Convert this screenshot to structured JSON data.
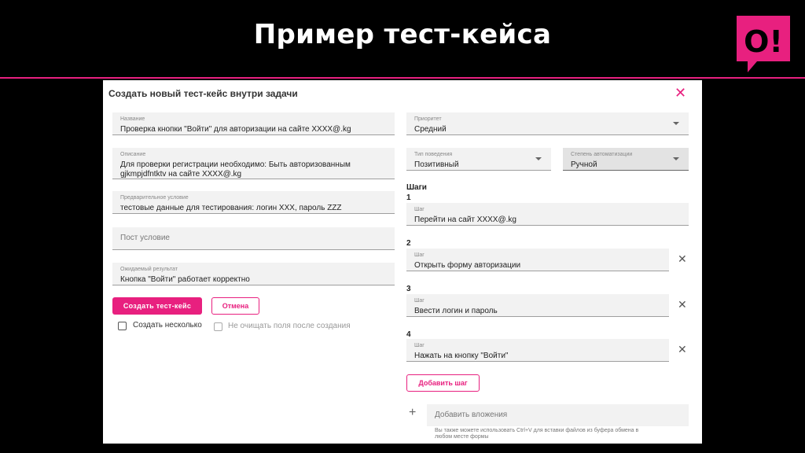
{
  "slide": {
    "title": "Пример тест-кейса",
    "logo_text": "О!",
    "accent_color": "#e8207f"
  },
  "dialog": {
    "title": "Создать новый тест-кейс внутри задачи",
    "close_icon": "close-icon",
    "fields": {
      "name": {
        "label": "Название",
        "value": "Проверка кнопки \"Войти\" для авторизации на сайте XXXX@.kg"
      },
      "description": {
        "label": "Описание",
        "value_line1": "Для проверки  регистрации необходимо: Быть авторизованным",
        "value_line2": "gjkmpjdfntktv  на сайте  XXXX@.kg"
      },
      "precondition": {
        "label": "Предварительное условие",
        "value": "тестовые данные для тестирования: логин XXX, пароль ZZZ"
      },
      "postcondition": {
        "placeholder": "Пост условие"
      },
      "expected": {
        "label": "Ожидаемый результат",
        "value": "Кнопка \"Войти\" работает корректно"
      }
    },
    "buttons": {
      "create": "Создать тест-кейс",
      "cancel": "Отмена",
      "add_step": "Добавить шаг"
    },
    "checkboxes": {
      "multiple": "Создать несколько",
      "keep_fields": "Не очищать поля после создания"
    },
    "priority": {
      "label": "Приоритет",
      "value": "Средний"
    },
    "behavior": {
      "label": "Тип поведения",
      "value": "Позитивный"
    },
    "automation": {
      "label": "Степень автоматизации",
      "value": "Ручной"
    },
    "steps_title": "Шаги",
    "steps": [
      {
        "num": "1",
        "label": "Шаг",
        "value": "Перейти на сайт XXXX@.kg"
      },
      {
        "num": "2",
        "label": "Шаг",
        "value": "Открыть форму авторизации"
      },
      {
        "num": "3",
        "label": "Шаг",
        "value": "Ввести логин и пароль"
      },
      {
        "num": "4",
        "label": "Шаг",
        "value": "Нажать на кнопку \"Войти\""
      }
    ],
    "attachments": {
      "placeholder": "Добавить вложения",
      "hint_line1": "Вы также можете использовать Ctrl+V для вставки файлов из буфера обмена в",
      "hint_line2": "любом месте формы"
    }
  }
}
